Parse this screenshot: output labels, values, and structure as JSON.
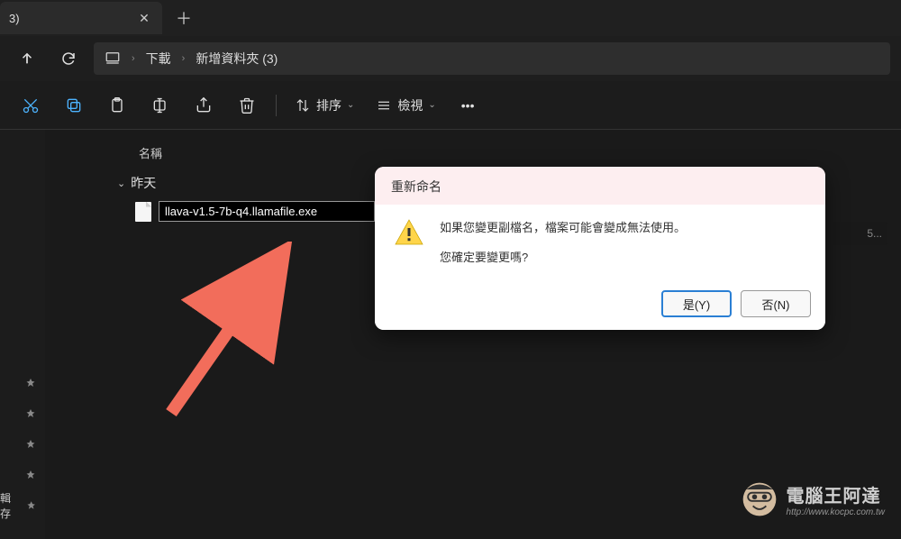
{
  "tab": {
    "title": "3)"
  },
  "breadcrumb": {
    "root_icon": "pc",
    "items": [
      "下載",
      "新增資料夾 (3)"
    ]
  },
  "toolbar": {
    "sort_label": "排序",
    "view_label": "檢視"
  },
  "columns": {
    "name": "名稱"
  },
  "group": {
    "label": "昨天"
  },
  "file": {
    "name_editing": "llava-v1.5-7b-q4.llamafile.exe"
  },
  "partial_cell": "5...",
  "dialog": {
    "title": "重新命名",
    "line1": "如果您變更副檔名，檔案可能會變成無法使用。",
    "line2": "您確定要變更嗎?",
    "yes": "是(Y)",
    "no": "否(N)"
  },
  "sidebar_last": "輯存",
  "watermark": {
    "title": "電腦王阿達",
    "url": "http://www.kocpc.com.tw"
  }
}
